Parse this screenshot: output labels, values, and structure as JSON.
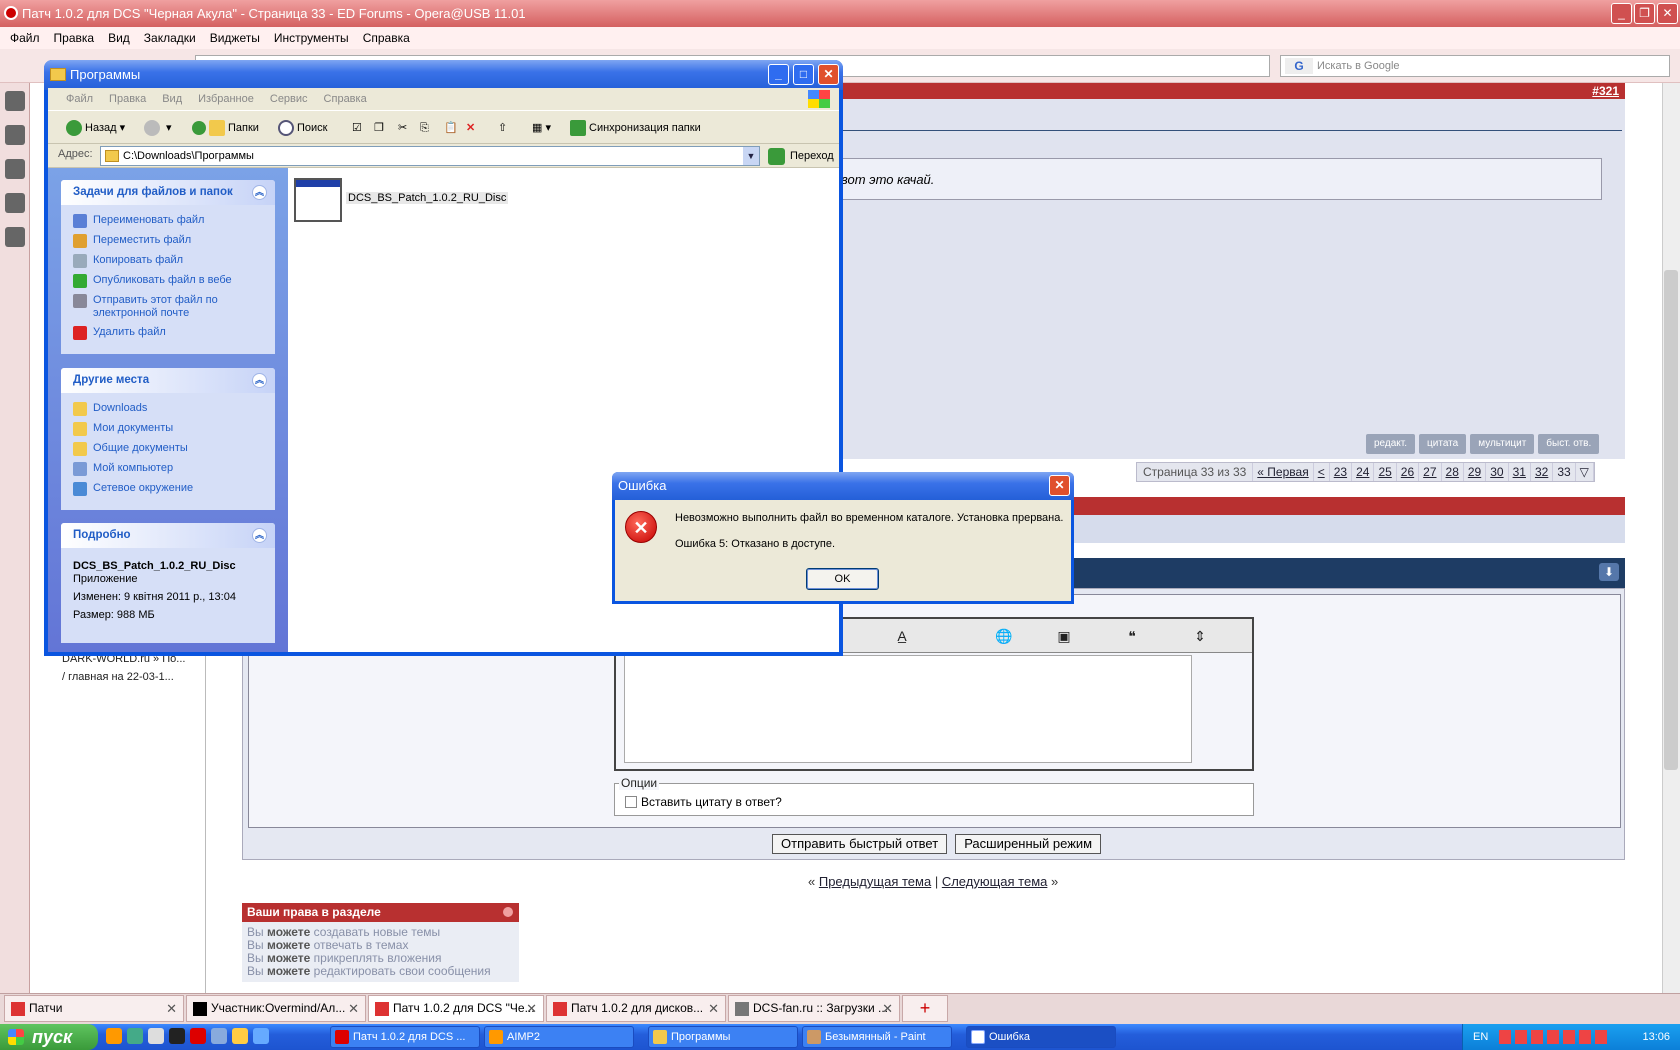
{
  "opera": {
    "title": "Патч 1.0.2 для DCS \"Черная Акула\" - Страница 33 - ED Forums - Opera@USB 11.01",
    "menu": [
      "Файл",
      "Правка",
      "Вид",
      "Закладки",
      "Виджеты",
      "Инструменты",
      "Справка"
    ],
    "search_placeholder": "Искать в Google",
    "search_engine": "G"
  },
  "forum": {
    "post_number": "#321",
    "quote_text": "вот это качай.",
    "post_actions": [
      "редакт.",
      "цитата",
      "мультицит",
      "быст. отв."
    ],
    "pager_info": "Страница 33 из 33",
    "pager_first": "« Первая",
    "pager_prev": "<",
    "pages": [
      "23",
      "24",
      "25",
      "26",
      "27",
      "28",
      "29",
      "30",
      "31",
      "32",
      "33"
    ],
    "options_legend": "Опции",
    "options_checkbox": "Вставить цитату в ответ?",
    "submit_quick": "Отправить быстрый ответ",
    "advanced_mode": "Расширенный режим",
    "prev_topic": "Предыдущая тема",
    "next_topic": "Следующая тема",
    "nav_open": "«",
    "nav_sep": "|",
    "nav_close": "»",
    "perm_title": "Ваши права в разделе",
    "perms": [
      {
        "pre": "Вы",
        "bold": "можете",
        "rest": "создавать новые темы"
      },
      {
        "pre": "Вы",
        "bold": "можете",
        "rest": "отвечать в темах"
      },
      {
        "pre": "Вы",
        "bold": "можете",
        "rest": "прикреплять вложения"
      },
      {
        "pre": "Вы",
        "bold": "можете",
        "rest": "редактировать свои сообщения"
      }
    ]
  },
  "panel_items": [
    "DARK-WORLD.ru » По...",
    "/ главная на 22-03-1..."
  ],
  "tabs": [
    {
      "label": "Патчи",
      "color": "#d33"
    },
    {
      "label": "Участник:Overmind/Ал...",
      "color": "#000"
    },
    {
      "label": "Патч 1.0.2 для DCS \"Че...",
      "color": "#d33"
    },
    {
      "label": "Патч 1.0.2 для дисков...",
      "color": "#d33"
    },
    {
      "label": "DCS-fan.ru :: Загрузки ...",
      "color": "#777"
    }
  ],
  "taskbar": {
    "start": "пуск",
    "tasks": [
      {
        "label": "Патч 1.0.2 для DCS ...",
        "color": "#d00"
      },
      {
        "label": "AIMP2",
        "color": "#f90"
      },
      {
        "label": "Программы",
        "color": "#f2c94c"
      },
      {
        "label": "Безымянный - Paint",
        "color": "#c96"
      },
      {
        "label": "Ошибка",
        "color": "#fff"
      }
    ],
    "lang": "EN",
    "clock": "13:06"
  },
  "explorer": {
    "title": "Программы",
    "menu": [
      "Файл",
      "Правка",
      "Вид",
      "Избранное",
      "Сервис",
      "Справка"
    ],
    "back": "Назад",
    "folders": "Папки",
    "search": "Поиск",
    "sync": "Синхронизация папки",
    "address_label": "Адрес:",
    "address": "C:\\Downloads\\Программы",
    "go": "Переход",
    "tasks_title": "Задачи для файлов и папок",
    "tasks": [
      {
        "label": "Переименовать файл",
        "color": "#5a7fd6"
      },
      {
        "label": "Переместить файл",
        "color": "#e0a030"
      },
      {
        "label": "Копировать файл",
        "color": "#9ab"
      },
      {
        "label": "Опубликовать файл в вебе",
        "color": "#3a3"
      },
      {
        "label": "Отправить этот файл по электронной почте",
        "color": "#889"
      },
      {
        "label": "Удалить файл",
        "color": "#d22"
      }
    ],
    "places_title": "Другие места",
    "places": [
      {
        "label": "Downloads",
        "color": "#f2c94c"
      },
      {
        "label": "Мои документы",
        "color": "#f2c94c"
      },
      {
        "label": "Общие документы",
        "color": "#f2c94c"
      },
      {
        "label": "Мой компьютер",
        "color": "#7a9ad6"
      },
      {
        "label": "Сетевое окружение",
        "color": "#4a8ad6"
      }
    ],
    "details_title": "Подробно",
    "details": {
      "name": "DCS_BS_Patch_1.0.2_RU_Disc",
      "type": "Приложение",
      "modified": "Изменен: 9 квітня 2011 р., 13:04",
      "size": "Размер: 988 МБ"
    },
    "file_name": "DCS_BS_Patch_1.0.2_RU_Disc"
  },
  "error_dialog": {
    "title": "Ошибка",
    "message": "Невозможно выполнить файл во временном каталоге. Установка прервана.",
    "detail": "Ошибка 5: Отказано в доступе.",
    "ok": "OK"
  }
}
